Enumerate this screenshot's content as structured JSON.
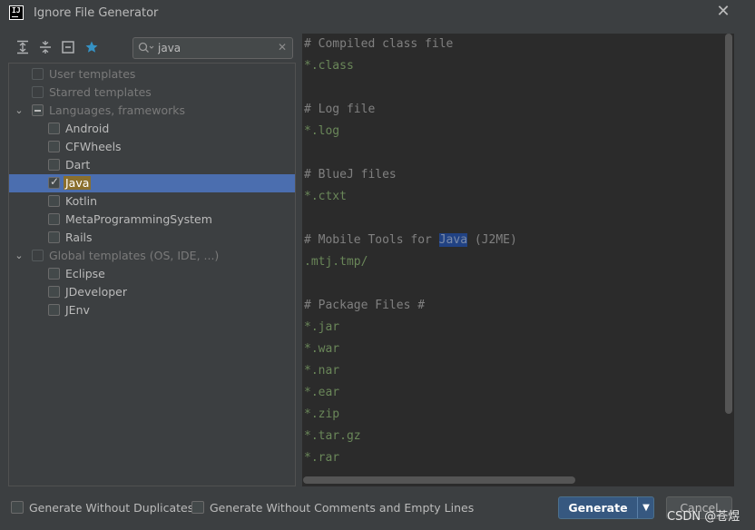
{
  "window": {
    "title": "Ignore File Generator",
    "close_glyph": "✕"
  },
  "toolbar": {
    "icons": [
      "expand-all-icon",
      "collapse-all-icon",
      "unselect-icon",
      "star-icon"
    ],
    "search": {
      "value": "java",
      "clear_glyph": "✕"
    }
  },
  "tree": {
    "rows": [
      {
        "label": "User templates",
        "checked": false,
        "disabled": true
      },
      {
        "label": "Starred templates",
        "checked": false,
        "disabled": true
      },
      {
        "label": "Languages, frameworks",
        "expanded": true,
        "state": "partial"
      },
      {
        "label": "Android",
        "checked": false
      },
      {
        "label": "CFWheels",
        "checked": false
      },
      {
        "label": "Dart",
        "checked": false
      },
      {
        "label": "Java",
        "checked": true,
        "selected": true
      },
      {
        "label": "Kotlin",
        "checked": false
      },
      {
        "label": "MetaProgrammingSystem",
        "checked": false
      },
      {
        "label": "Rails",
        "checked": false
      },
      {
        "label": "Global templates (OS, IDE, ...)",
        "expanded": true,
        "disabled": true
      },
      {
        "label": "Eclipse",
        "checked": false
      },
      {
        "label": "JDeveloper",
        "checked": false
      },
      {
        "label": "JEnv",
        "checked": false
      }
    ]
  },
  "editor": {
    "lines": [
      "# Compiled class file",
      "*.class",
      "",
      "# Log file",
      "*.log",
      "",
      "# BlueJ files",
      "*.ctxt",
      "",
      "# Mobile Tools for Java (J2ME)",
      ".mtj.tmp/",
      "",
      "# Package Files #",
      "*.jar",
      "*.war",
      "*.nar",
      "*.ear",
      "*.zip",
      "*.tar.gz",
      "*.rar"
    ],
    "highlight_word": "Java"
  },
  "bottom": {
    "without_duplicates": "Generate Without Duplicates",
    "without_comments": "Generate Without Comments and Empty Lines",
    "generate": "Generate",
    "cancel": "Cancel",
    "dropdown_glyph": "▼"
  },
  "watermark": "CSDN @苍煜"
}
